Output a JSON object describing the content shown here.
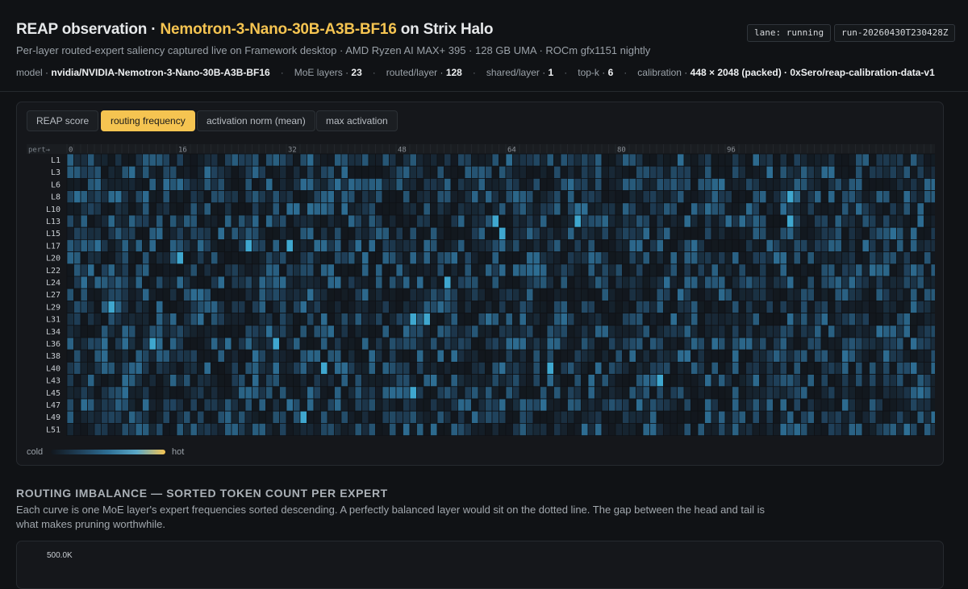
{
  "header": {
    "title_prefix": "REAP observation · ",
    "title_model": "Nemotron-3-Nano-30B-A3B-BF16",
    "title_suffix": " on Strix Halo",
    "subtitle": "Per-layer routed-expert saliency captured live on Framework desktop · AMD Ryzen AI MAX+ 395 · 128 GB UMA · ROCm gfx1151 nightly",
    "lane_badge": "lane: running",
    "run_badge": "run-20260430T230428Z",
    "meta": [
      {
        "label": "model · ",
        "value": "nvidia/NVIDIA-Nemotron-3-Nano-30B-A3B-BF16"
      },
      {
        "label": "MoE layers · ",
        "value": "23"
      },
      {
        "label": "routed/layer · ",
        "value": "128"
      },
      {
        "label": "shared/layer · ",
        "value": "1"
      },
      {
        "label": "top-k · ",
        "value": "6"
      },
      {
        "label": "calibration · ",
        "value": "448 × 2048 (packed) · 0xSero/reap-calibration-data-v1"
      }
    ]
  },
  "tabs": [
    {
      "label": "REAP score",
      "active": false
    },
    {
      "label": "routing frequency",
      "active": true
    },
    {
      "label": "activation norm (mean)",
      "active": false
    },
    {
      "label": "max activation",
      "active": false
    }
  ],
  "heatmap": {
    "corner_label": "pert→",
    "col_ticks": [
      0,
      16,
      32,
      48,
      64,
      80,
      96
    ],
    "num_cols": 128,
    "rows": [
      "L1",
      "L3",
      "L6",
      "L8",
      "L10",
      "L13",
      "L15",
      "L17",
      "L20",
      "L22",
      "L24",
      "L27",
      "L29",
      "L31",
      "L34",
      "L36",
      "L38",
      "L40",
      "L43",
      "L45",
      "L47",
      "L49",
      "L51"
    ],
    "hot_cells": [
      [
        3,
        105
      ],
      [
        5,
        62
      ],
      [
        5,
        74
      ],
      [
        5,
        105
      ],
      [
        6,
        63
      ],
      [
        7,
        26
      ],
      [
        7,
        32
      ],
      [
        7,
        26
      ],
      [
        8,
        16
      ],
      [
        10,
        55
      ],
      [
        12,
        6
      ],
      [
        13,
        50
      ],
      [
        13,
        52
      ],
      [
        15,
        12
      ],
      [
        15,
        30
      ],
      [
        17,
        37
      ],
      [
        17,
        70
      ],
      [
        18,
        86
      ],
      [
        19,
        50
      ],
      [
        21,
        34
      ]
    ],
    "legend_cold": "cold",
    "legend_hot": "hot",
    "colors": {
      "cold": "#12171d",
      "mid": "#2e6f95",
      "hot_cell": "#3fa7cf",
      "legend_hot": "#f5c451"
    }
  },
  "imbalance": {
    "title": "ROUTING IMBALANCE — SORTED TOKEN COUNT PER EXPERT",
    "description": "Each curve is one MoE layer's expert frequencies sorted descending. A perfectly balanced layer would sit on the dotted line. The gap between the head and tail is what makes pruning worthwhile.",
    "y_max_label": "500.0K"
  }
}
